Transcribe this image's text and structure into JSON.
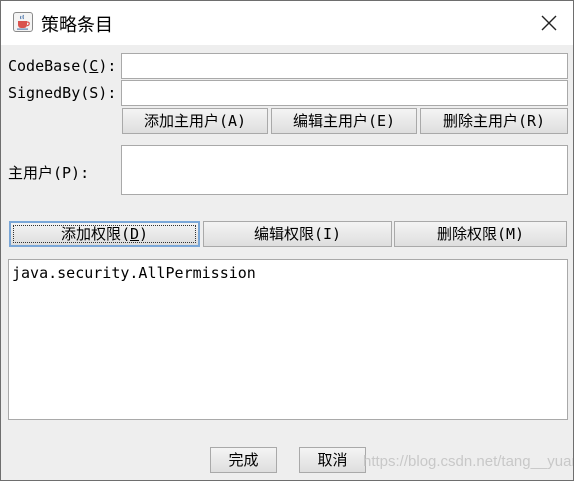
{
  "window": {
    "title": "策略条目"
  },
  "codebase": {
    "label_prefix": "CodeBase(",
    "label_mnemonic": "C",
    "label_suffix": "):",
    "value": ""
  },
  "signedby": {
    "label": "SignedBy(S):",
    "value": ""
  },
  "principal_buttons": {
    "add": "添加主用户(A)",
    "edit": "编辑主用户(E)",
    "remove": "删除主用户(R)"
  },
  "principals": {
    "label": "主用户(P):",
    "items": []
  },
  "permission_buttons": {
    "add_prefix": "添加权限(",
    "add_mnemonic": "D",
    "add_suffix": ")",
    "edit": "编辑权限(I)",
    "remove": "删除权限(M)"
  },
  "permissions": {
    "items": [
      "java.security.AllPermission"
    ]
  },
  "footer": {
    "done": "完成",
    "cancel": "取消"
  },
  "watermark": "https://blog.csdn.net/tang__yuan",
  "icons": {
    "app": "java-coffee-cup-icon",
    "close": "close-icon"
  }
}
